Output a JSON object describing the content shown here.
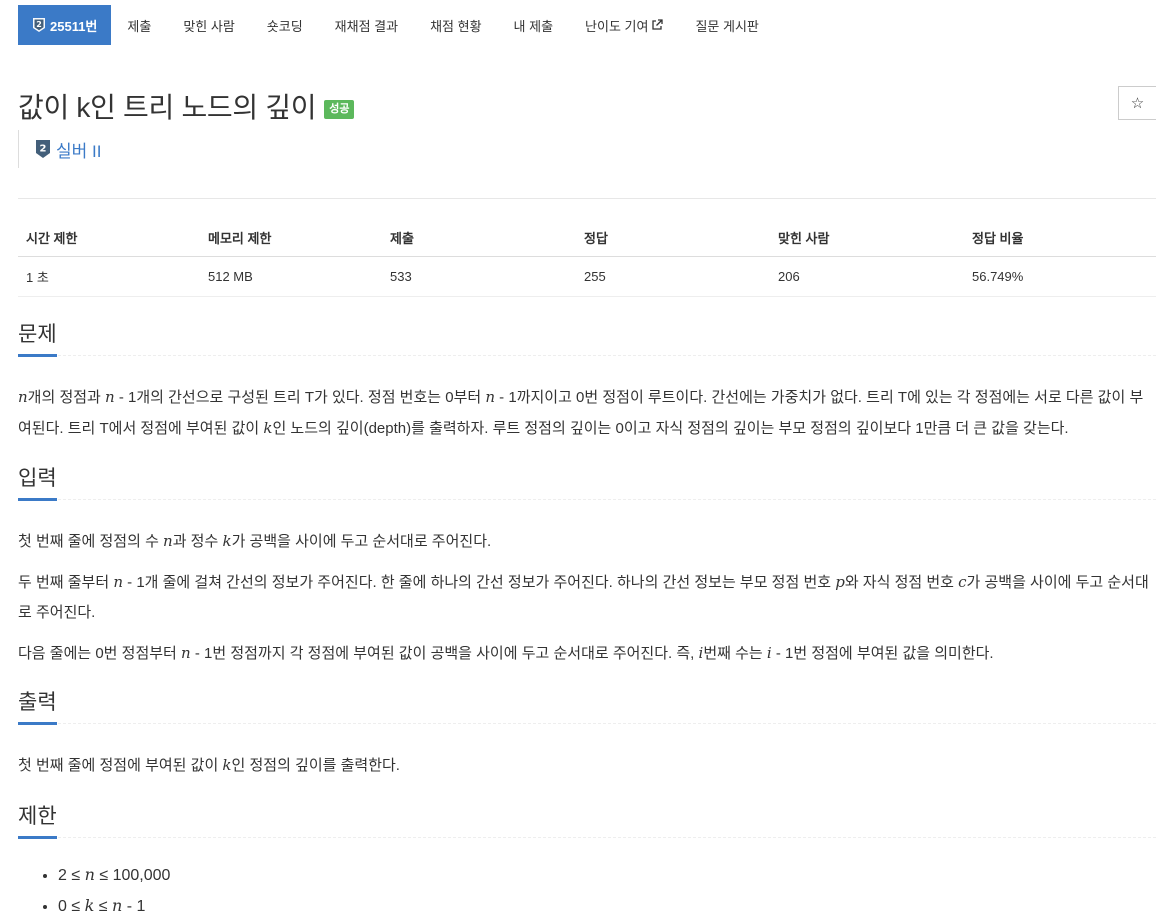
{
  "nav": {
    "problem_id": "25511번",
    "items": [
      "제출",
      "맞힌 사람",
      "숏코딩",
      "재채점 결과",
      "채점 현황",
      "내 제출",
      "난이도 기여",
      "질문 게시판"
    ]
  },
  "title": "값이 k인 트리 노드의 깊이",
  "status": "성공",
  "tier": {
    "label": "실버 II",
    "number": "2"
  },
  "star_icon": "☆",
  "table": {
    "headers": [
      "시간 제한",
      "메모리 제한",
      "제출",
      "정답",
      "맞힌 사람",
      "정답 비율"
    ],
    "values": [
      "1 초",
      "512 MB",
      "533",
      "255",
      "206",
      "56.749%"
    ]
  },
  "sections": {
    "problem": {
      "title": "문제",
      "p1_a": "개의 정점과 ",
      "p1_b": " - 1개의 간선으로 구성된 트리 T가 있다. 정점 번호는 0부터 ",
      "p1_c": " - 1까지이고 0번 정점이 루트이다. 간선에는 가중치가 없다. 트리 T에 있는 각 정점에는 서로 다른 값이 부여된다. 트리 T에서 정점에 부여된 값이 ",
      "p1_d": "인 노드의 깊이(depth)를 출력하자. 루트 정점의 깊이는 0이고 자식 정점의 깊이는 부모 정점의 깊이보다 1만큼 더 큰 값을 갖는다."
    },
    "input": {
      "title": "입력",
      "p1_a": "첫 번째 줄에 정점의 수 ",
      "p1_b": "과 정수 ",
      "p1_c": "가 공백을 사이에 두고 순서대로 주어진다.",
      "p2_a": "두 번째 줄부터 ",
      "p2_b": " - 1개 줄에 걸쳐 간선의 정보가 주어진다. 한 줄에 하나의 간선 정보가 주어진다. 하나의 간선 정보는 부모 정점 번호 ",
      "p2_c": "와 자식 정점 번호 ",
      "p2_d": "가 공백을 사이에 두고 순서대로 주어진다.",
      "p3_a": "다음 줄에는 0번 정점부터 ",
      "p3_b": " - 1번 정점까지 각 정점에 부여된 값이 공백을 사이에 두고 순서대로 주어진다. 즉, ",
      "p3_c": "번째 수는 ",
      "p3_d": " - 1번 정점에 부여된 값을 의미한다."
    },
    "output": {
      "title": "출력",
      "p1_a": "첫 번째 줄에 정점에 부여된 값이 ",
      "p1_b": "인 정점의 깊이를 출력한다."
    },
    "limits": {
      "title": "제한",
      "l1_a": "2 ≤ ",
      "l1_b": " ≤ 100,000",
      "l2_a": "0 ≤ ",
      "l2_b": " ≤ ",
      "l2_c": " - 1"
    }
  },
  "vars": {
    "n": "n",
    "k": "k",
    "p": "p",
    "c": "c",
    "i": "i"
  },
  "colors": {
    "accent": "#3b7ac7",
    "success": "#5cb85c",
    "text": "#333333"
  }
}
